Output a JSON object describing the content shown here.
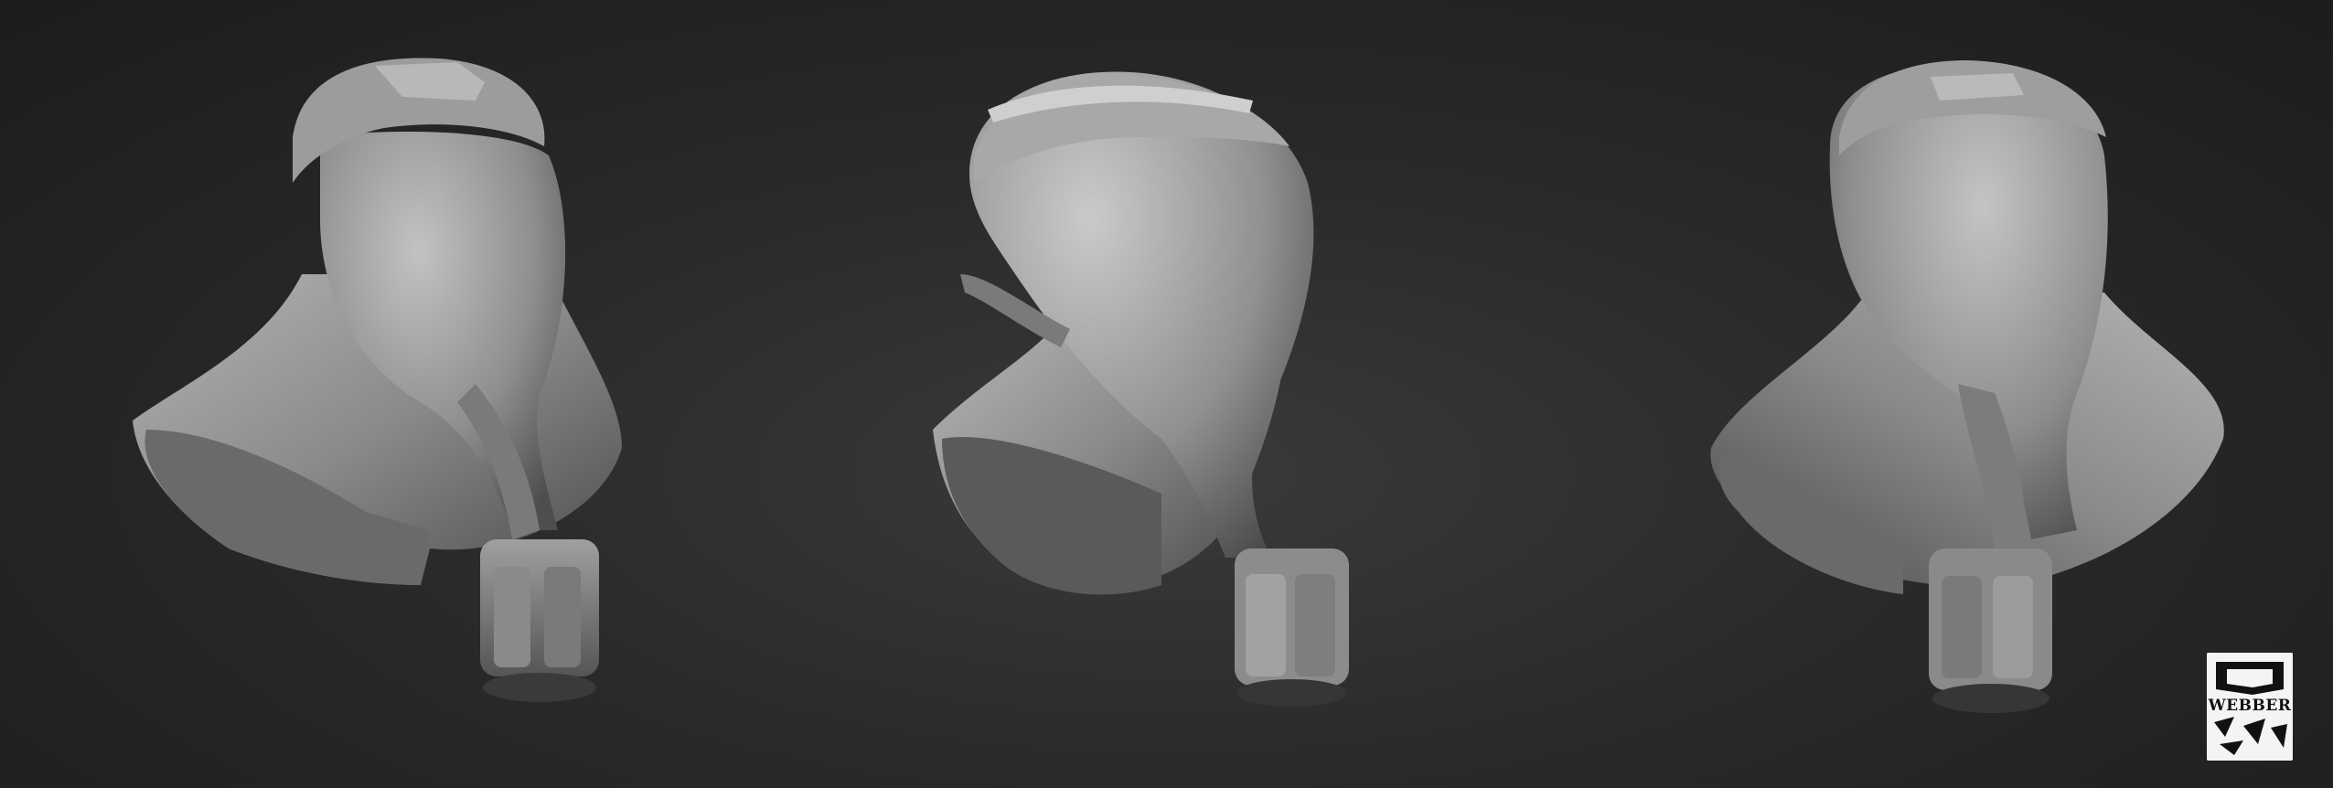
{
  "scene": {
    "subject": "alien-bust",
    "background_color": "#262626",
    "material_color": "#8c8c8c",
    "views": [
      {
        "id": "left",
        "angle": "three-quarter-left"
      },
      {
        "id": "center",
        "angle": "profile-right"
      },
      {
        "id": "right",
        "angle": "three-quarter-right"
      }
    ]
  },
  "watermark": {
    "text": "WEBBER"
  }
}
